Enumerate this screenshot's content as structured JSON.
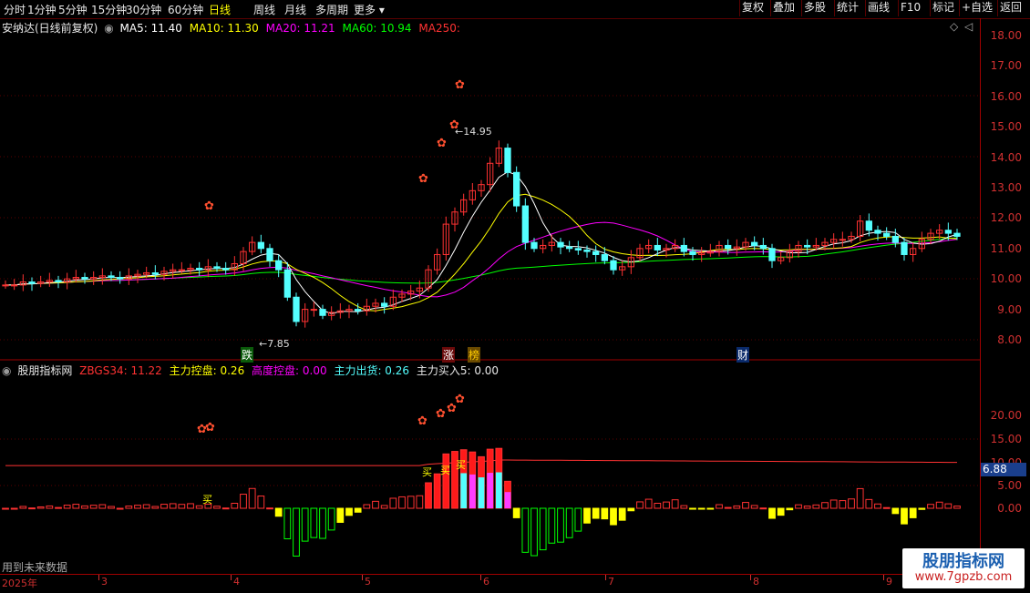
{
  "toolbar": {
    "periods": [
      "分时",
      "1分钟",
      "5分钟",
      "15分钟",
      "30分钟",
      "60分钟",
      "日线",
      "周线",
      "月线",
      "多周期",
      "更多"
    ],
    "active_period": "日线",
    "right_buttons": [
      "复权",
      "叠加",
      "多股",
      "统计",
      "画线",
      "F10",
      "标记",
      "+自选",
      "返回"
    ]
  },
  "main_legend": {
    "title": "安纳达(日线前复权)",
    "ma5": "MA5: 11.40",
    "ma10": "MA10: 11.30",
    "ma20": "MA20: 11.21",
    "ma60": "MA60: 10.94",
    "ma250": "MA250:"
  },
  "ind_legend": {
    "title": "股朋指标网",
    "zbgs": "ZBGS34: 11.22",
    "zlkp": "主力控盘: 0.26",
    "gdkp": "高度控盘: 0.00",
    "zlch": "主力出货: 0.26",
    "zlmr": "主力买入5: 0.00"
  },
  "price_axis": [
    "18.00",
    "17.00",
    "16.00",
    "15.00",
    "14.00",
    "13.00",
    "12.00",
    "11.00",
    "10.00",
    "9.00",
    "8.00"
  ],
  "ind_axis": [
    "20.00",
    "15.00",
    "10.00",
    "5.00",
    "0.00"
  ],
  "ind_current_value": "6.88",
  "annotations": {
    "high": "14.95",
    "low": "7.85"
  },
  "markers": {
    "fall": "跌",
    "rise": "涨",
    "list": "榜",
    "finance": "财",
    "buy": "买"
  },
  "footer": {
    "year": "2025年",
    "months": [
      "3",
      "4",
      "5",
      "6",
      "7",
      "8",
      "9"
    ]
  },
  "notice": "用到未来数据",
  "watermark": {
    "line1": "股朋指标网",
    "line2": "www.7gpzb.com"
  },
  "colors": {
    "up": "#ff3232",
    "down": "#54ffff",
    "ma5": "#ffffff",
    "ma10": "#ffff00",
    "ma20": "#ff00ff",
    "ma60": "#00ff00",
    "axis": "#d03030"
  },
  "chart_data": {
    "type": "candlestick",
    "close": [
      9.8,
      9.8,
      9.9,
      9.85,
      9.9,
      9.95,
      9.9,
      10,
      10.05,
      10,
      10.05,
      10.1,
      10.05,
      10,
      10.1,
      10.15,
      10.2,
      10.15,
      10.25,
      10.3,
      10.3,
      10.35,
      10.3,
      10.4,
      10.35,
      10.3,
      10.5,
      10.9,
      11.2,
      11,
      10.6,
      10.3,
      9.4,
      8.6,
      9,
      9,
      8.8,
      8.9,
      8.95,
      9,
      8.95,
      9.1,
      9.2,
      9.1,
      9.4,
      9.5,
      9.6,
      9.7,
      10.3,
      10.8,
      11.8,
      12.2,
      12.6,
      12.9,
      13.1,
      13.8,
      14.3,
      13.5,
      12.4,
      11.2,
      11,
      11.1,
      11.2,
      11.05,
      11,
      10.95,
      10.9,
      10.8,
      10.6,
      10.3,
      10.4,
      10.7,
      11,
      11.1,
      10.95,
      11,
      11.1,
      10.9,
      10.8,
      10.85,
      10.9,
      11.1,
      11,
      11.05,
      11.2,
      11.1,
      11,
      10.6,
      10.7,
      10.9,
      11.1,
      11.05,
      11.1,
      11.2,
      11.3,
      11.3,
      11.4,
      11.9,
      11.6,
      11.5,
      11.4,
      11.2,
      10.8,
      11,
      11.3,
      11.5,
      11.6,
      11.5,
      11.4
    ],
    "main_ylim": [
      7.5,
      18.3
    ],
    "ind_ylim": [
      -2,
      23
    ]
  }
}
